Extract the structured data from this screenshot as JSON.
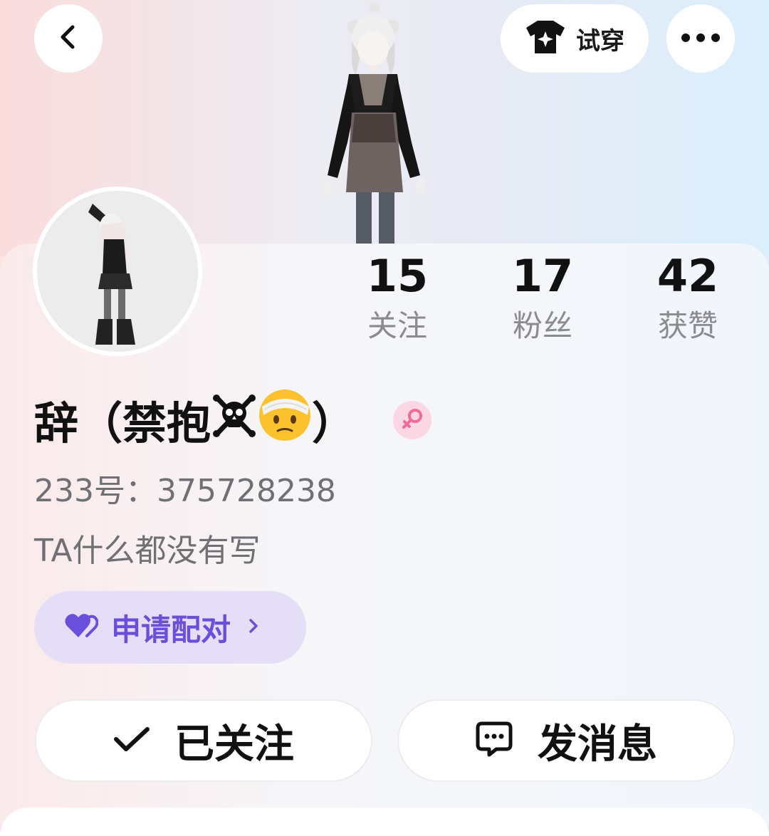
{
  "header": {
    "try_on_label": "试穿",
    "icons": {
      "back": "chevron-left-icon",
      "try_on": "tshirt-sparkle-icon",
      "more": "more-dots-icon"
    }
  },
  "stats": [
    {
      "value": "15",
      "label": "关注"
    },
    {
      "value": "17",
      "label": "粉丝"
    },
    {
      "value": "42",
      "label": "获赞"
    }
  ],
  "profile": {
    "name_prefix": "辞（禁抱",
    "name_suffix": "）",
    "name_emojis": [
      "skull-crossbones-emoji",
      "bandaged-face-emoji"
    ],
    "gender": "female-symbol",
    "id_line": "233号：375728238",
    "bio": "TA什么都没有写"
  },
  "pair": {
    "label": "申请配对"
  },
  "actions": {
    "follow_label": "已关注",
    "message_label": "发消息"
  },
  "colors": {
    "accent_purple": "#6a4fdc",
    "pair_bg": "#e4def7",
    "gender_pink": "#f06a9a",
    "gender_bg": "#fbd7e4"
  }
}
